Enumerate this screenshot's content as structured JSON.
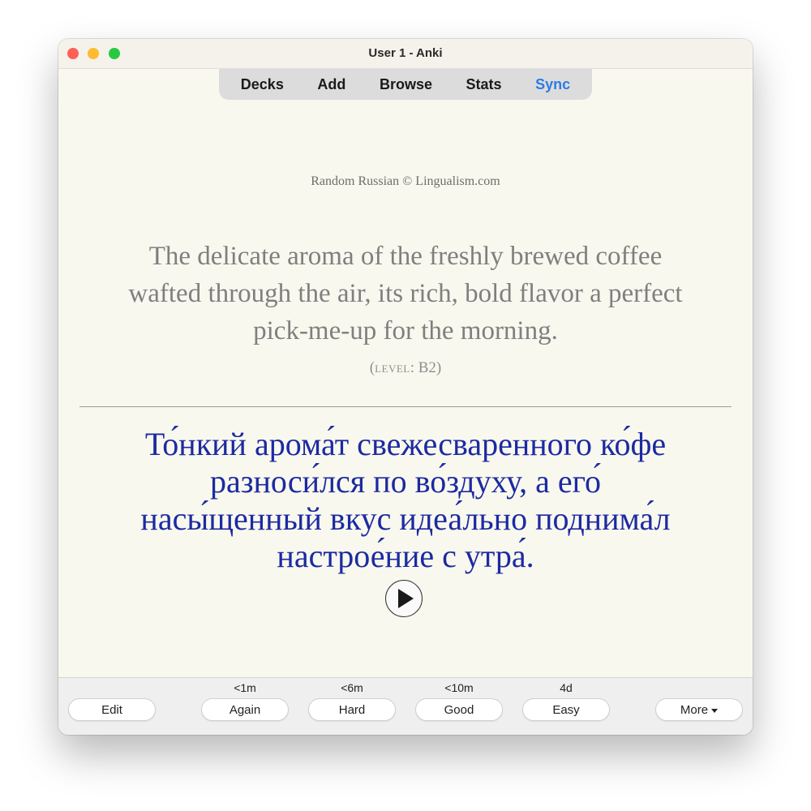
{
  "window": {
    "title": "User 1 - Anki",
    "traffic_colors": {
      "close": "#fe5f57",
      "minimize": "#febc2e",
      "maximize": "#28c840"
    }
  },
  "toolbar": {
    "decks": "Decks",
    "add": "Add",
    "browse": "Browse",
    "stats": "Stats",
    "sync": "Sync",
    "sync_color": "#2c7be5"
  },
  "card": {
    "credit": "Random Russian © Lingualism.com",
    "english_lines": [
      "The delicate aroma of the freshly brewed coffee",
      "wafted through the air, its rich, bold flavor a perfect",
      "pick-me-up for the morning."
    ],
    "level_open": "(",
    "level_label": "level",
    "level_value": ": B2)",
    "russian_lines": [
      "То́нкий арома́т свежесваренного ко́фе",
      "разноси́лся по во́здуху, а его́",
      "насы́щенный вкус идеа́льно поднима́л",
      "настрое́ние с утра́."
    ],
    "play_icon": "play-icon",
    "russian_color": "#1c2aa1"
  },
  "answer_bar": {
    "edit": "Edit",
    "again": {
      "label": "Again",
      "interval": "<1m"
    },
    "hard": {
      "label": "Hard",
      "interval": "<6m"
    },
    "good": {
      "label": "Good",
      "interval": "<10m"
    },
    "easy": {
      "label": "Easy",
      "interval": "4d"
    },
    "more": "More"
  }
}
